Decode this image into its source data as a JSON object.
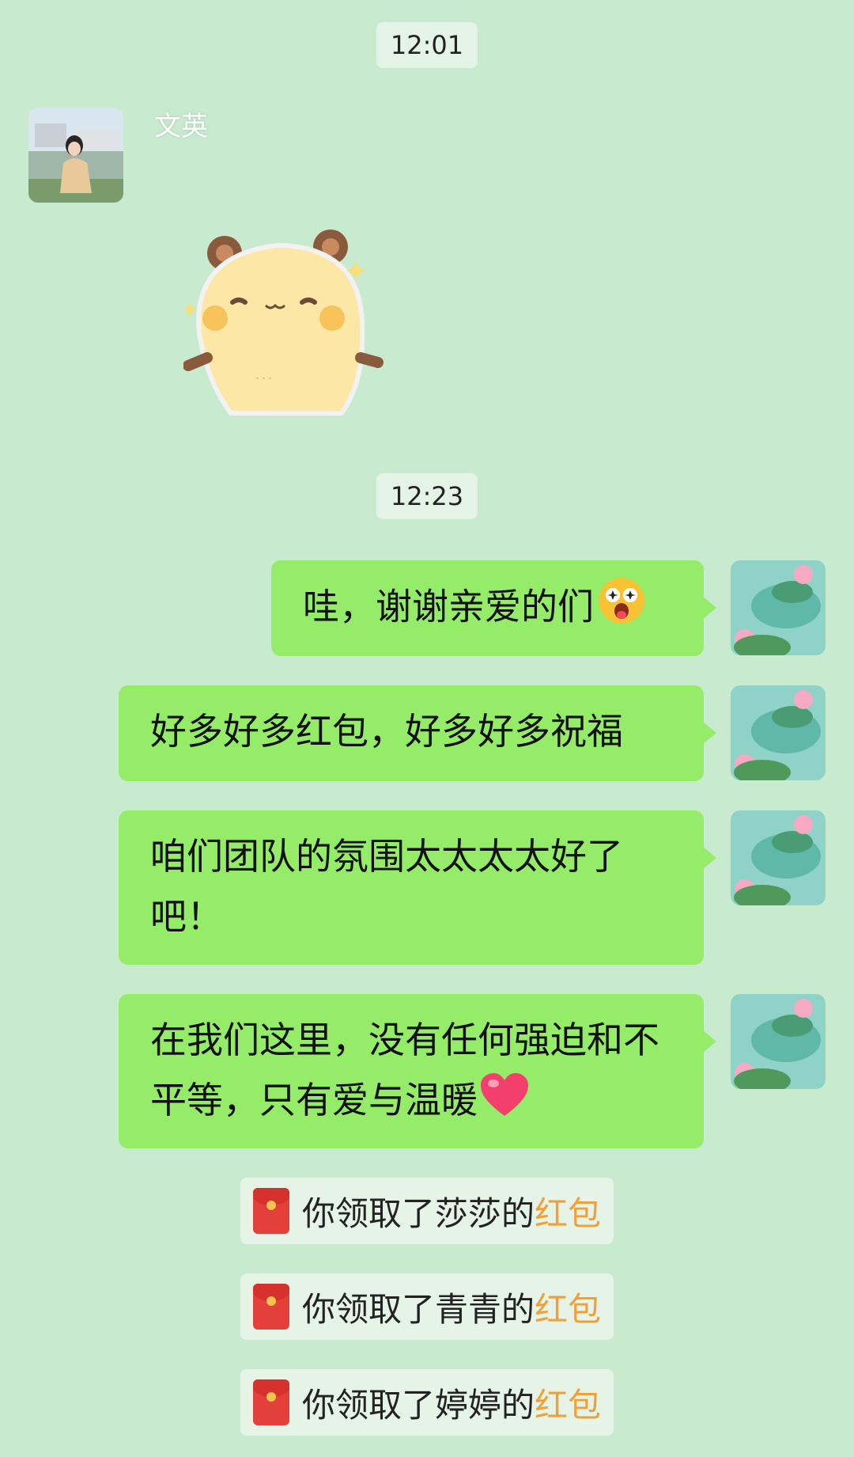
{
  "chat": {
    "timestamps": [
      "12:01",
      "12:23"
    ],
    "incoming": {
      "sender_name": "文英",
      "sticker": "bear-sticker"
    },
    "outgoing_messages": [
      {
        "text": "哇，谢谢亲爱的们",
        "emoji": "star-eyes-emoji"
      },
      {
        "text": "好多好多红包，好多好多祝福"
      },
      {
        "text": "咱们团队的氛围太太太太好了吧！"
      },
      {
        "text": "在我们这里，没有任何强迫和不平等，只有爱与温暖",
        "emoji": "heart-emoji"
      }
    ],
    "red_packets": [
      {
        "prefix": "你领取了莎莎的",
        "link": "红包"
      },
      {
        "prefix": "你领取了青青的",
        "link": "红包"
      },
      {
        "prefix": "你领取了婷婷的",
        "link": "红包"
      }
    ]
  },
  "colors": {
    "background": "#c8ebcf",
    "bubble": "#95ec69",
    "red_packet_link": "#f0a03a"
  }
}
